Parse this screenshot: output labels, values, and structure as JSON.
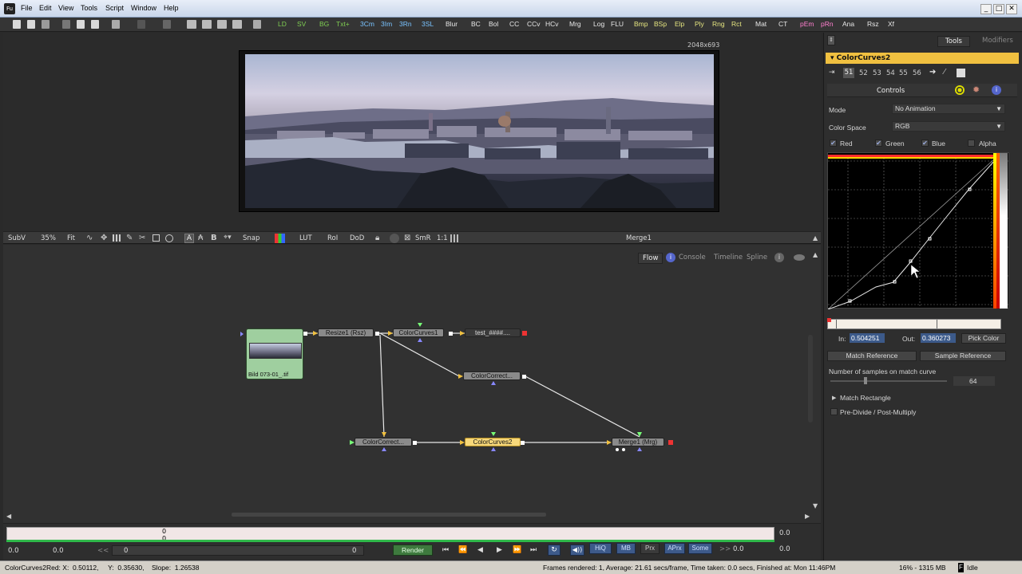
{
  "menu": [
    "File",
    "Edit",
    "View",
    "Tools",
    "Script",
    "Window",
    "Help"
  ],
  "window_controls": [
    "_",
    "□",
    "✕"
  ],
  "app_icon": "Fu",
  "toolbar": {
    "buttons": [
      "LD",
      "SV",
      "BG",
      "Txt+",
      "3Cm",
      "3Im",
      "3Rn",
      "3SL",
      "Blur",
      "BC",
      "Bol",
      "CC",
      "CCv",
      "HCv",
      "Mrg",
      "Log",
      "FLU",
      "Bmp",
      "BSp",
      "Elp",
      "Ply",
      "Rng",
      "Rct",
      "Mat",
      "CT",
      "pEm",
      "pRn",
      "Ana",
      "Rsz",
      "Xf"
    ],
    "colors": {
      "green": "#7fce52",
      "cyan": "#79c3ff",
      "yellow": "#e6e680",
      "pink": "#ff7fcf",
      "white": "#e8e8e8"
    }
  },
  "viewer": {
    "resolution": "2048x693",
    "subv": "SubV",
    "zoom": "35%",
    "fit": "Fit",
    "snap": "Snap",
    "lut": "LUT",
    "roi": "RoI",
    "dod": "DoD",
    "smr": "SmR",
    "ratio": "1:1",
    "name": "Merge1"
  },
  "flow_tabs": [
    "Flow",
    "Console",
    "Timeline",
    "Spline"
  ],
  "nodes": {
    "loader": "Bild 073-01_.tif",
    "resize": "Resize1 (Rsz)",
    "curves1": "ColorCurves1",
    "saver": "test_####....",
    "cc_top": "ColorCorrect...",
    "cc_bottom": "ColorCorrect...",
    "curves2": "ColorCurves2",
    "merge": "Merge1 (Mrg)"
  },
  "timeline": {
    "ruler_top": "0",
    "ruler_bottom": "0",
    "right_value": "0.0",
    "start": "0.0",
    "current": "0.0",
    "back": "<<",
    "range_start": "0",
    "range_end": "0",
    "render": "Render",
    "forward": ">>",
    "end_value": "0.0",
    "end_value2": "0.0",
    "buttons": [
      "HiQ",
      "MB",
      "Prx",
      "APrx",
      "Some"
    ]
  },
  "status": {
    "left": "ColorCurves2Red: X:  0.50112,     Y:  0.35630,    Slope:  1.26538",
    "frames": "Frames rendered: 1,  Average: 21.61 secs/frame,  Time taken: 0.0 secs,  Finished at: Mon 11:46PM",
    "memory": "16% - 1315 MB",
    "state": "Idle"
  },
  "panel": {
    "tab_tools": "Tools",
    "tab_modifiers": "Modifiers",
    "tool_name": "ColorCurves2",
    "slots": [
      "51",
      "52",
      "53",
      "54",
      "55",
      "56"
    ],
    "controls_tab": "Controls",
    "mode_label": "Mode",
    "mode_value": "No Animation",
    "colorspace_label": "Color Space",
    "colorspace_value": "RGB",
    "channels": [
      "Red",
      "Green",
      "Blue",
      "Alpha"
    ],
    "in_label": "In:",
    "in_value": "0.504251",
    "out_label": "Out:",
    "out_value": "0.360273",
    "pick_color": "Pick Color",
    "match_reference": "Match Reference",
    "sample_reference": "Sample Reference",
    "samples_label": "Number of samples on match curve",
    "samples_value": "64",
    "match_rectangle": "Match Rectangle",
    "predivide": "Pre-Divide / Post-Multiply"
  }
}
